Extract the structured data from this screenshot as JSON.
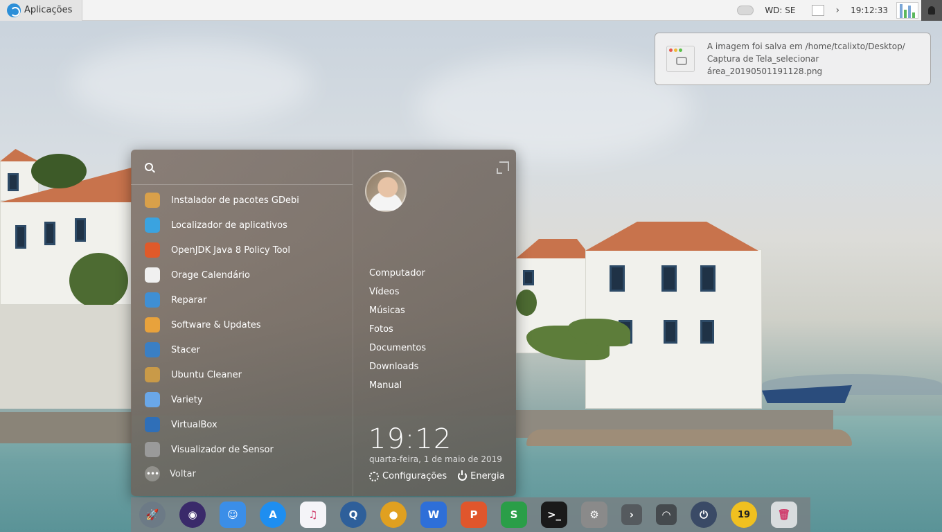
{
  "topbar": {
    "apps_label": "Aplicações",
    "weather_label": "WD: SE",
    "time": "19:12:33",
    "chevron": "›"
  },
  "notification": {
    "line1": "A imagem foi salva em /home/tcalixto/Desktop/",
    "line2": "Captura de Tela_selecionar área_20190501191128.png"
  },
  "menu": {
    "search_placeholder": "",
    "apps": [
      {
        "label": "Instalador de pacotes GDebi",
        "icon": "package-icon",
        "color": "#d9a04a"
      },
      {
        "label": "Localizador de aplicativos",
        "icon": "search-app-icon",
        "color": "#3aa3e0"
      },
      {
        "label": "OpenJDK Java 8 Policy Tool",
        "icon": "java-icon",
        "color": "#e05a2a"
      },
      {
        "label": "Orage Calendário",
        "icon": "calendar-icon",
        "color": "#f0f0f0"
      },
      {
        "label": "Reparar",
        "icon": "repair-icon",
        "color": "#3f8fd4"
      },
      {
        "label": "Software & Updates",
        "icon": "software-updates-icon",
        "color": "#e8a23c"
      },
      {
        "label": "Stacer",
        "icon": "stacer-icon",
        "color": "#3a7fc4"
      },
      {
        "label": "Ubuntu Cleaner",
        "icon": "broom-icon",
        "color": "#c99a48"
      },
      {
        "label": "Variety",
        "icon": "variety-icon",
        "color": "#6aa7e8"
      },
      {
        "label": "VirtualBox",
        "icon": "virtualbox-icon",
        "color": "#2f6fb8"
      },
      {
        "label": "Visualizador de Sensor",
        "icon": "thermometer-icon",
        "color": "#9a9a9a"
      }
    ],
    "back_label": "Voltar",
    "places": [
      "Computador",
      "Vídeos",
      "Músicas",
      "Fotos",
      "Documentos",
      "Downloads",
      "Manual"
    ],
    "clock": "19:12",
    "date": "quarta-feira, 1 de maio de 2019",
    "settings_label": "Configurações",
    "power_label": "Energia"
  },
  "dock": {
    "items": [
      {
        "name": "launcher-rocket-icon",
        "color": "#6c7a86",
        "glyph": "🚀"
      },
      {
        "name": "siri-icon",
        "color": "#3a2a6a",
        "glyph": "◉"
      },
      {
        "name": "finder-icon",
        "color": "#3b8ee8",
        "glyph": "☺"
      },
      {
        "name": "app-store-icon",
        "color": "#1e8ef0",
        "glyph": "A"
      },
      {
        "name": "music-icon",
        "color": "#f4f4f8",
        "glyph": "♫"
      },
      {
        "name": "quicktime-icon",
        "color": "#2e5f9a",
        "glyph": "Q"
      },
      {
        "name": "chrome-icon",
        "color": "#e0a020",
        "glyph": "●"
      },
      {
        "name": "wps-writer-icon",
        "color": "#2e6fd8",
        "glyph": "W"
      },
      {
        "name": "wps-presentation-icon",
        "color": "#e0562c",
        "glyph": "P"
      },
      {
        "name": "wps-spreadsheet-icon",
        "color": "#2a9e48",
        "glyph": "S"
      },
      {
        "name": "terminal-icon",
        "color": "#1a1a1a",
        "glyph": ">_"
      },
      {
        "name": "system-settings-icon",
        "color": "#8a8a8a",
        "glyph": "⚙"
      },
      {
        "name": "dock-expand-icon",
        "color": "#555a5e",
        "glyph": "›"
      },
      {
        "name": "wifi-icon",
        "color": "#454a4e",
        "glyph": "◠"
      },
      {
        "name": "power-button-icon",
        "color": "#3a4a66",
        "glyph": "⏻"
      },
      {
        "name": "clock-widget-icon",
        "color": "#f0c020",
        "glyph": "19"
      },
      {
        "name": "trash-icon",
        "color": "#d8dcde",
        "glyph": "🗑"
      }
    ]
  }
}
